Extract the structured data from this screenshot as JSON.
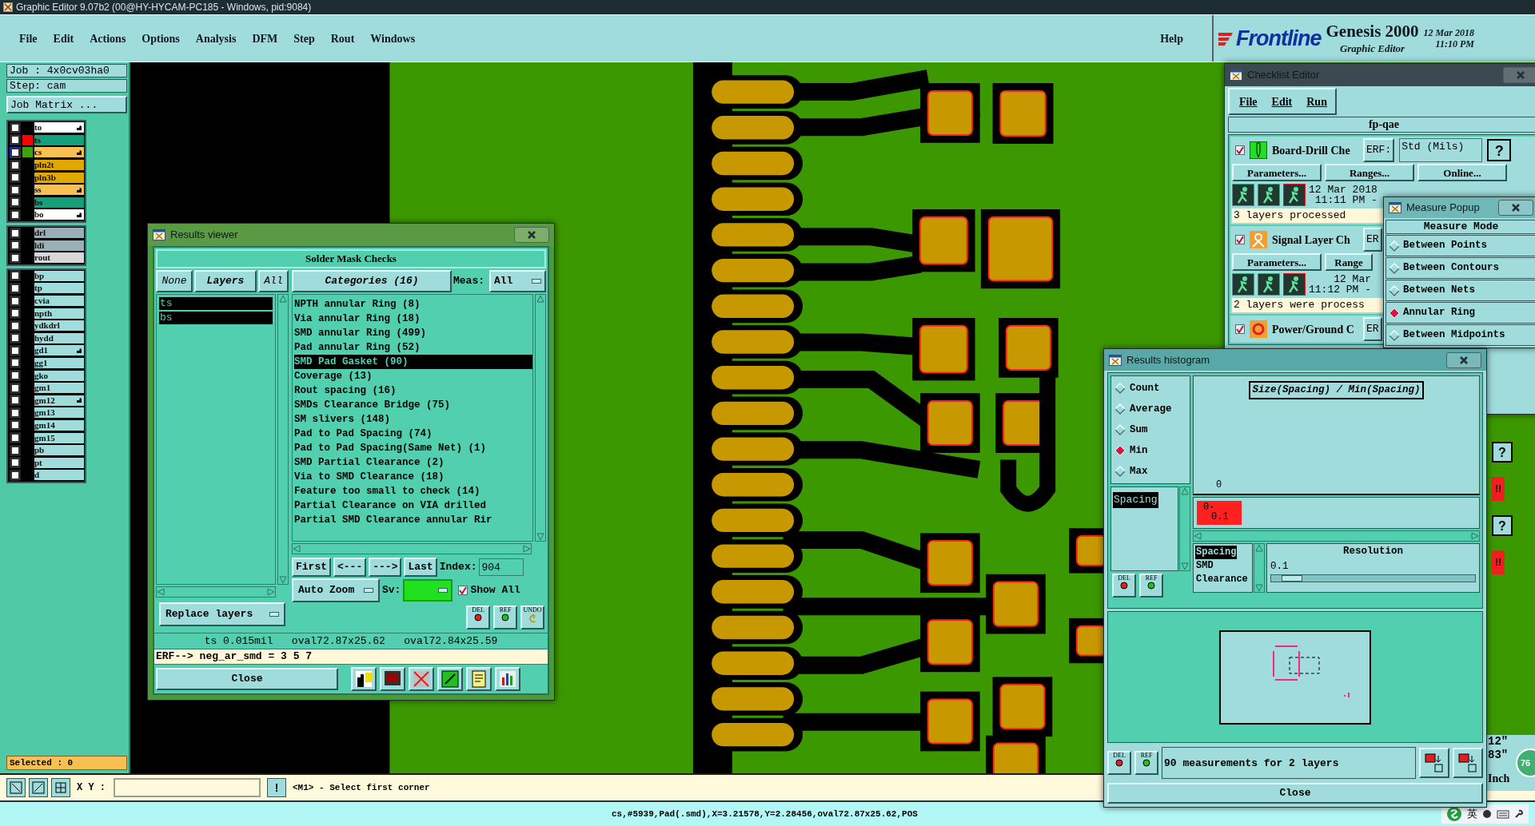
{
  "window": {
    "title": "Graphic Editor 9.07b2 (00@HY-HYCAM-PC185 - Windows, pid:9084)"
  },
  "menu": [
    {
      "label": "File"
    },
    {
      "label": "Edit"
    },
    {
      "label": "Actions"
    },
    {
      "label": "Options"
    },
    {
      "label": "Analysis"
    },
    {
      "label": "DFM"
    },
    {
      "label": "Step"
    },
    {
      "label": "Rout"
    },
    {
      "label": "Windows"
    }
  ],
  "help_menu": "Help",
  "brand": {
    "logo": "Frontline",
    "product": "Genesis 2000",
    "subtitle": "Graphic Editor",
    "date": "12 Mar 2018",
    "time": "11:10 PM"
  },
  "job_info": {
    "job": "Job : 4x0cv03ha0",
    "step": "Step: cam",
    "matrix_button": "Job Matrix ..."
  },
  "layer_groups": [
    {
      "layers": [
        {
          "name": "to",
          "color": "#ffffff",
          "affected": true,
          "work": false
        },
        {
          "name": "ts",
          "color": "#14a07a",
          "display": {
            "color": "#ff0000"
          },
          "affected": false,
          "work": false
        },
        {
          "name": "cs",
          "color": "#f8c050",
          "display": {
            "color": "#40a010"
          },
          "affected": true,
          "work": true
        },
        {
          "name": "pln2t",
          "color": "#e0a800",
          "affected": false,
          "work": false
        },
        {
          "name": "pln3b",
          "color": "#e0a800",
          "affected": false,
          "work": false
        },
        {
          "name": "ss",
          "color": "#f8c050",
          "affected": true,
          "work": false
        },
        {
          "name": "bs",
          "color": "#14a07a",
          "affected": false,
          "work": false
        },
        {
          "name": "bo",
          "color": "#ffffff",
          "affected": true,
          "work": false
        }
      ]
    },
    {
      "layers": [
        {
          "name": "drl",
          "color": "#9ab0b8",
          "affected": false,
          "work": false
        },
        {
          "name": "ldi",
          "color": "#9ab0b8",
          "affected": false,
          "work": false
        },
        {
          "name": "rout",
          "color": "#d8d8d8",
          "affected": false,
          "work": false
        }
      ]
    },
    {
      "layers": [
        {
          "name": "bp",
          "color": "#a0dcdc",
          "affected": false,
          "work": false
        },
        {
          "name": "tp",
          "color": "#a0dcdc",
          "affected": false,
          "work": false
        },
        {
          "name": "cvia",
          "color": "#a0dcdc",
          "affected": false,
          "work": false
        },
        {
          "name": "npth",
          "color": "#a0dcdc",
          "affected": false,
          "work": false
        },
        {
          "name": "ydkdrl",
          "color": "#a0dcdc",
          "affected": false,
          "work": false
        },
        {
          "name": "hydd",
          "color": "#a0dcdc",
          "affected": false,
          "work": false
        },
        {
          "name": "gd1",
          "color": "#a0dcdc",
          "affected": true,
          "work": false
        },
        {
          "name": "gg1",
          "color": "#a0dcdc",
          "affected": false,
          "work": false
        },
        {
          "name": "gko",
          "color": "#a0dcdc",
          "affected": false,
          "work": false
        },
        {
          "name": "gm1",
          "color": "#a0dcdc",
          "affected": false,
          "work": false
        },
        {
          "name": "gm12",
          "color": "#a0dcdc",
          "affected": true,
          "work": false
        },
        {
          "name": "gm13",
          "color": "#a0dcdc",
          "affected": false,
          "work": false
        },
        {
          "name": "gm14",
          "color": "#a0dcdc",
          "affected": false,
          "work": false
        },
        {
          "name": "gm15",
          "color": "#a0dcdc",
          "affected": false,
          "work": false
        },
        {
          "name": "pb",
          "color": "#a0dcdc",
          "affected": false,
          "work": false
        },
        {
          "name": "pt",
          "color": "#a0dcdc",
          "affected": false,
          "work": false
        },
        {
          "name": "d",
          "color": "#a0dcdc",
          "affected": false,
          "work": false
        }
      ]
    }
  ],
  "selected_count": "Selected : 0",
  "command_bar": {
    "xy_label": "X Y :",
    "alert_button": "!",
    "prompt": "<M1> - Select first corner"
  },
  "status_bar": {
    "text": "cs,#5939,Pad(.smd),X=3.21578,Y=2.28456,oval72.87x25.62,POS",
    "input_method": "英"
  },
  "results_viewer": {
    "title": "Results viewer",
    "heading": "Solder Mask Checks",
    "layer_buttons": [
      "None",
      "Layers",
      "All"
    ],
    "layers": [
      {
        "name": "ts",
        "selected": true
      },
      {
        "name": "bs",
        "selected": true
      }
    ],
    "categories_button": "Categories (16)",
    "meas_label": "Meas:",
    "meas_value": "All",
    "categories": [
      {
        "label": "NPTH annular Ring (8)",
        "selected": false
      },
      {
        "label": "Via annular Ring (18)",
        "selected": false
      },
      {
        "label": "SMD annular Ring (499)",
        "selected": false
      },
      {
        "label": "Pad annular Ring (52)",
        "selected": false
      },
      {
        "label": "SMD Pad Gasket (90)",
        "selected": true
      },
      {
        "label": "Coverage (13)",
        "selected": false
      },
      {
        "label": "Rout spacing (16)",
        "selected": false
      },
      {
        "label": "SMDs Clearance Bridge (75)",
        "selected": false
      },
      {
        "label": "SM slivers (148)",
        "selected": false
      },
      {
        "label": "Pad to Pad Spacing (74)",
        "selected": false
      },
      {
        "label": "Pad to Pad Spacing(Same Net) (1)",
        "selected": false
      },
      {
        "label": "SMD Partial Clearance (2)",
        "selected": false
      },
      {
        "label": "Via to SMD Clearance (18)",
        "selected": false
      },
      {
        "label": "Feature too small to check (14)",
        "selected": false
      },
      {
        "label": "Partial Clearance on VIA drilled",
        "selected": false
      },
      {
        "label": "Partial SMD Clearance annular Rir",
        "selected": false
      }
    ],
    "nav_buttons": [
      "First",
      "<---",
      "--->",
      "Last"
    ],
    "index_label": "Index:",
    "index_value": "904",
    "zoom_mode": "Auto Zoom",
    "sv_label": "Sv:",
    "show_all": {
      "label": "Show All",
      "checked": true
    },
    "replace_layers": "Replace layers",
    "tool_buttons": [
      "DEL",
      "REF",
      "UNDO"
    ],
    "measurement": "ts 0.015mil   oval72.87x25.62   oval72.84x25.59",
    "erf": "ERF--> neg_ar_smd = 3 5 7",
    "close": "Close"
  },
  "checklist_editor": {
    "title": "Checklist Editor",
    "menu": [
      "File",
      "Edit",
      "Run"
    ],
    "checklist_name": "fp-qae",
    "actions": [
      {
        "kind": "drill",
        "name": "Board-Drill Che",
        "checked": true,
        "erf_label": "ERF:",
        "erf_value": "Std (Mils)",
        "buttons": [
          "Parameters...",
          "Ranges...",
          "Online..."
        ],
        "date": "12 Mar 2018",
        "time": "11:11 PM -",
        "status": "3 layers processed"
      },
      {
        "kind": "signal",
        "name": "Signal Layer Ch",
        "checked": true,
        "erf_label": "ER",
        "buttons": [
          "Parameters...",
          "Range"
        ],
        "date": "12 Mar",
        "time": "11:12 PM -",
        "status": "2 layers were process"
      },
      {
        "kind": "power",
        "name": "Power/Ground C",
        "checked": true,
        "erf_label": "ER"
      }
    ],
    "help_marks": [
      "?",
      "?",
      "?"
    ],
    "alerts": [
      "!!",
      "!!"
    ],
    "coords": [
      "12\"",
      "83\""
    ],
    "unit": "Inch",
    "badge": "76"
  },
  "measure_popup": {
    "title": "Measure Popup",
    "heading": "Measure Mode",
    "modes": [
      {
        "label": "Between Points",
        "selected": false
      },
      {
        "label": "Between Contours",
        "selected": false
      },
      {
        "label": "Between Nets",
        "selected": false
      },
      {
        "label": "Annular Ring",
        "selected": true
      },
      {
        "label": "Between Midpoints",
        "selected": false
      }
    ]
  },
  "histogram": {
    "title": "Results histogram",
    "stats": [
      {
        "label": "Count",
        "selected": false
      },
      {
        "label": "Average",
        "selected": false
      },
      {
        "label": "Sum",
        "selected": false
      },
      {
        "label": "Min",
        "selected": true
      },
      {
        "label": "Max",
        "selected": false
      }
    ],
    "attributes": [
      {
        "label": "Spacing",
        "selected": true
      }
    ],
    "chart_title": "Size(Spacing) / Min(Spacing)",
    "bar_count": "0",
    "bar_range": [
      "0-",
      "0.1"
    ],
    "sub_attributes": [
      {
        "label": "Spacing",
        "selected": true
      },
      {
        "label": "SMD",
        "selected": false
      },
      {
        "label": "Clearance",
        "selected": false
      }
    ],
    "resolution_label": "Resolution",
    "resolution_value": "0.1",
    "resolution": {
      "level": 0.05
    },
    "tool_buttons": [
      "DEL",
      "REF"
    ],
    "summary_buttons": [
      "DEL",
      "REF"
    ],
    "summary": "90 measurements for 2 layers",
    "close": "Close"
  }
}
